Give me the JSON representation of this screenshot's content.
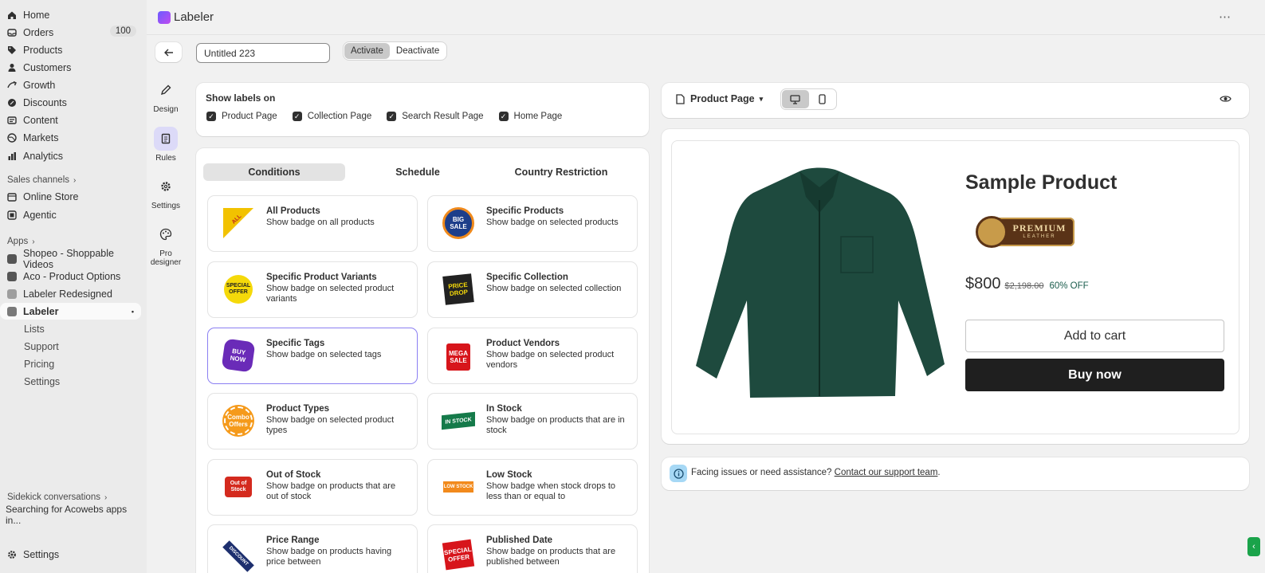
{
  "nav": {
    "home": "Home",
    "orders": "Orders",
    "orders_count": "100",
    "products": "Products",
    "customers": "Customers",
    "growth": "Growth",
    "discounts": "Discounts",
    "content": "Content",
    "markets": "Markets",
    "analytics": "Analytics",
    "sales_channels": "Sales channels",
    "online_store": "Online Store",
    "agentic": "Agentic",
    "apps": "Apps",
    "app_shopeo": "Shopeo - Shoppable Videos",
    "app_aco": "Aco - Product Options",
    "app_labeler_redesigned": "Labeler Redesigned",
    "app_labeler": "Labeler",
    "sub_lists": "Lists",
    "sub_support": "Support",
    "sub_pricing": "Pricing",
    "sub_settings": "Settings",
    "sidekick": "Sidekick conversations",
    "sidekick_item": "Searching for Acowebs apps in...",
    "settings": "Settings"
  },
  "header": {
    "title": "Labeler",
    "more": "⋯"
  },
  "toolbar": {
    "label_name": "Untitled 223",
    "activate": "Activate",
    "deactivate": "Deactivate"
  },
  "rail": {
    "design": "Design",
    "rules": "Rules",
    "settings": "Settings",
    "pro_designer_1": "Pro",
    "pro_designer_2": "designer"
  },
  "show_labels": {
    "title": "Show labels on",
    "options": [
      "Product Page",
      "Collection Page",
      "Search Result Page",
      "Home Page"
    ]
  },
  "tabs": [
    "Conditions",
    "Schedule",
    "Country Restriction"
  ],
  "rules": [
    {
      "title": "All Products",
      "desc": "Show badge on all products",
      "badge": "ALL PRODUCTS"
    },
    {
      "title": "Specific Products",
      "desc": "Show badge on selected products",
      "badge": "BIG SALE"
    },
    {
      "title": "Specific Product Variants",
      "desc": "Show badge on selected product variants",
      "badge": "SPECIAL OFFER"
    },
    {
      "title": "Specific Collection",
      "desc": "Show badge on selected collection",
      "badge": "PRICE DROP"
    },
    {
      "title": "Specific Tags",
      "desc": "Show badge on selected tags",
      "badge": "BUY NOW"
    },
    {
      "title": "Product Vendors",
      "desc": "Show badge on selected product vendors",
      "badge": "MEGA SALE"
    },
    {
      "title": "Product Types",
      "desc": "Show badge on selected product types",
      "badge": "Combo Offers"
    },
    {
      "title": "In Stock",
      "desc": "Show badge on products that are in stock",
      "badge": "IN STOCK"
    },
    {
      "title": "Out of Stock",
      "desc": "Show badge on products that are out of stock",
      "badge": "Out of Stock"
    },
    {
      "title": "Low Stock",
      "desc": "Show badge when stock drops to less than or equal to",
      "badge": "LOW STOCK"
    },
    {
      "title": "Price Range",
      "desc": "Show badge on products having price between",
      "badge": "DISCOUNT"
    },
    {
      "title": "Published Date",
      "desc": "Show badge on products that are published between",
      "badge": "SPECIAL OFFER"
    }
  ],
  "preview": {
    "page_select": "Product Page",
    "product_title": "Sample Product",
    "badge_text_1": "PREMIUM",
    "badge_text_2": "LEATHER",
    "price": "$800",
    "compare_price": "$2,198.00",
    "discount": "60% OFF",
    "add_to_cart": "Add to cart",
    "buy_now": "Buy now"
  },
  "support": {
    "text": "Facing issues or need assistance?",
    "link": "Contact our support team",
    "suffix": "."
  },
  "colors": {
    "accent": "#8b7ff2",
    "shirt": "#1e4a3e",
    "discount_text": "#1a5c4c",
    "badge_brown": "#5a3317"
  }
}
